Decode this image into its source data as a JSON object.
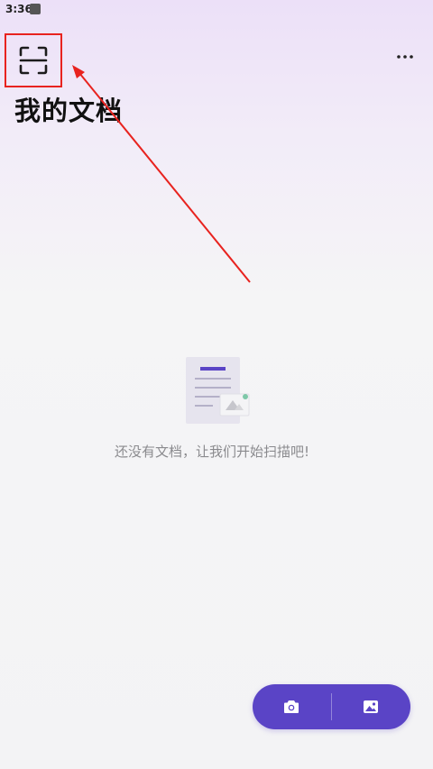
{
  "status_bar": {
    "time": "3:36"
  },
  "header": {
    "title": "我的文档"
  },
  "empty_state": {
    "message": "还没有文档，让我们开始扫描吧!"
  },
  "icons": {
    "scan": "scan-frame-icon",
    "more": "more-horizontal-icon",
    "camera": "camera-icon",
    "gallery": "image-icon",
    "document": "document-illustration-icon"
  },
  "colors": {
    "accent": "#5a44c6",
    "annotation": "#e8231f"
  }
}
